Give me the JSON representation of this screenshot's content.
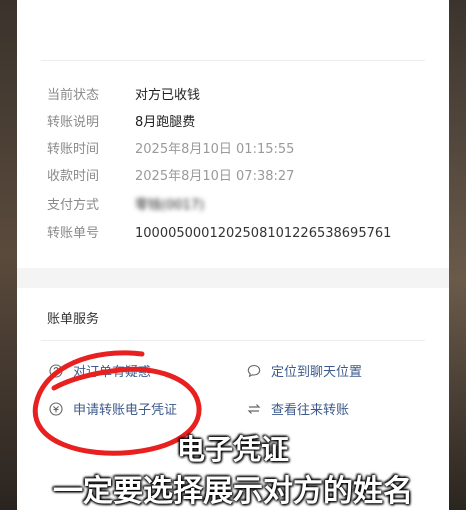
{
  "details": {
    "status_label": "当前状态",
    "status_value": "对方已收钱",
    "note_label": "转账说明",
    "note_value": "8月跑腿费",
    "transfer_time_label": "转账时间",
    "transfer_time_value": "2025年8月10日 01:15:55",
    "receive_time_label": "收款时间",
    "receive_time_value": "2025年8月10日 07:38:27",
    "payment_method_label": "支付方式",
    "payment_method_value": "零钱(0017)",
    "order_no_label": "转账单号",
    "order_no_value": "1000050001202508101226538695761"
  },
  "services": {
    "section_title": "账单服务",
    "doubt_label": "对订单有疑惑",
    "locate_chat_label": "定位到聊天位置",
    "voucher_label": "申请转账电子凭证",
    "history_label": "查看往来转账"
  },
  "overlay": {
    "caption_line1": "电子凭证",
    "caption_line2": "一定要选择展示对方的姓名",
    "highlight_color": "#e8201f"
  },
  "icons": [
    "question-icon",
    "chat-bubble-icon",
    "voucher-icon",
    "transfer-arrows-icon"
  ]
}
